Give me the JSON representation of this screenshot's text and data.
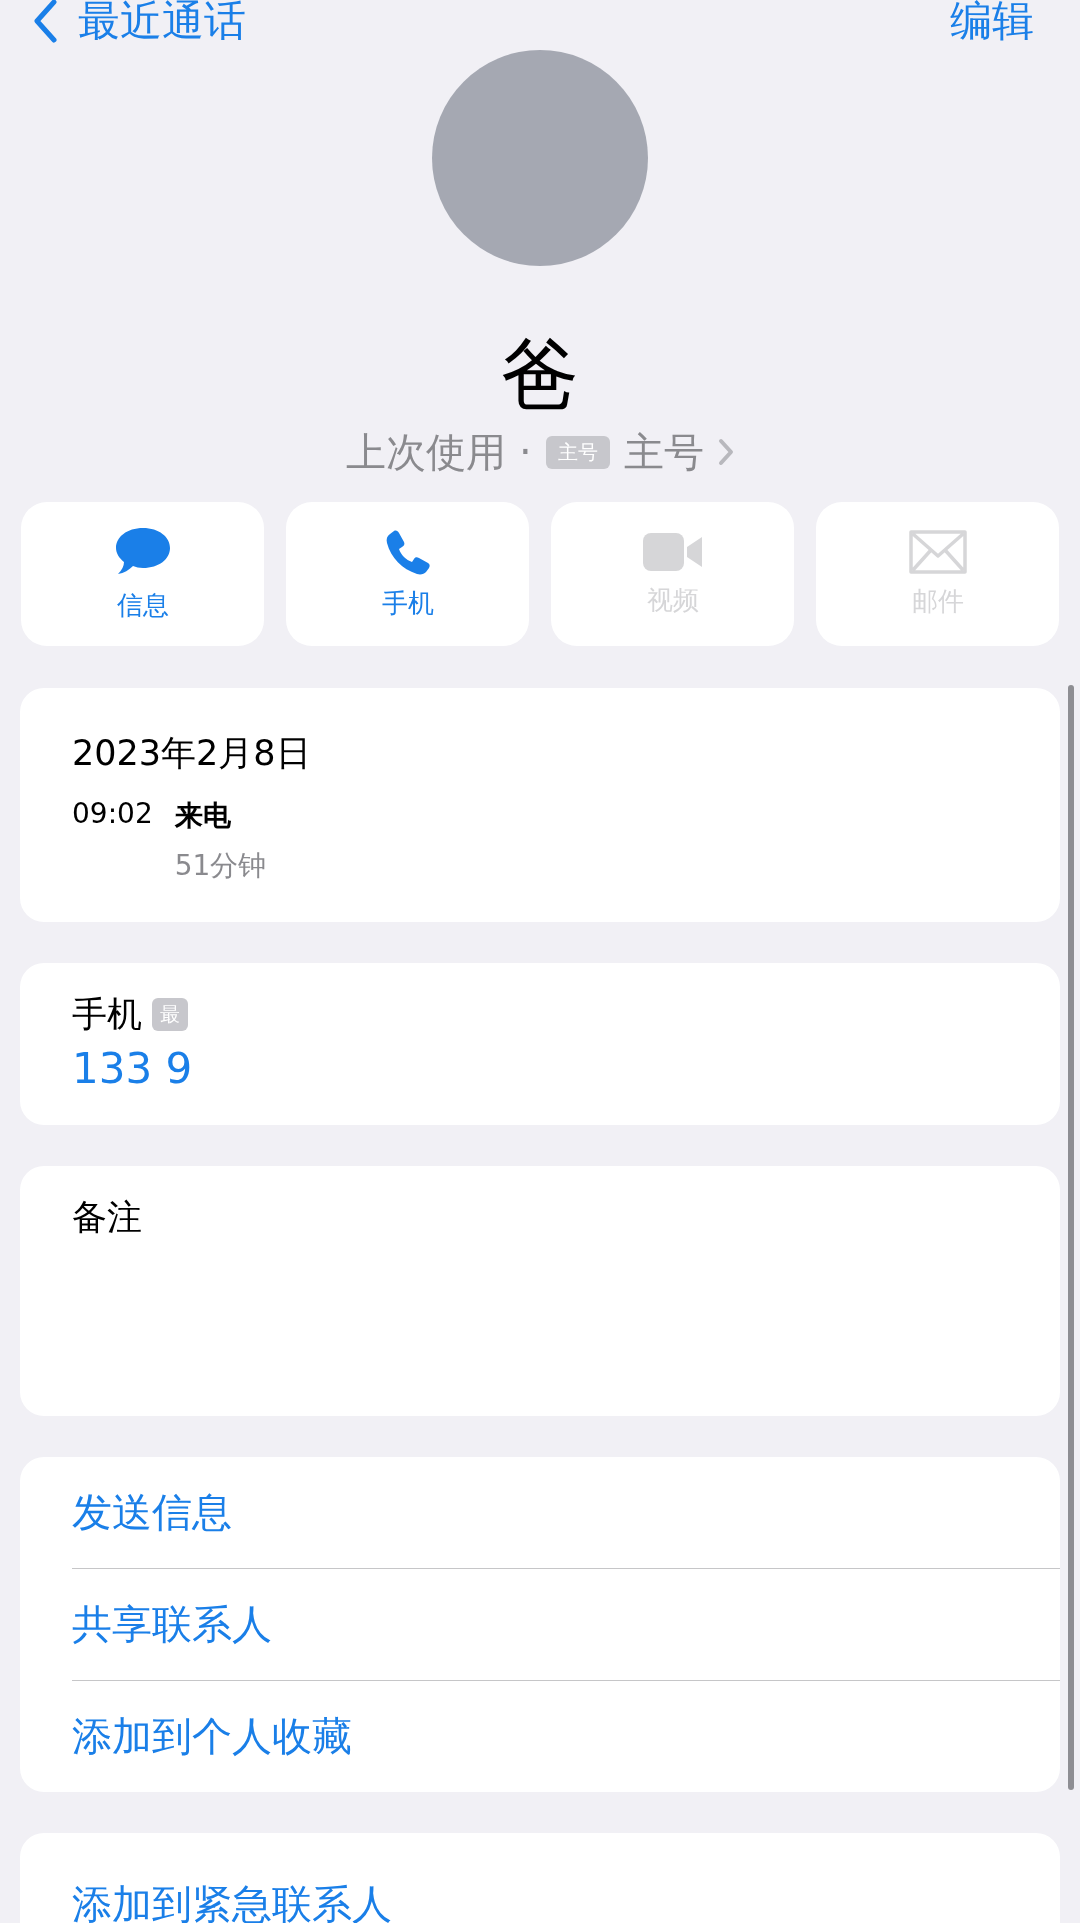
{
  "nav": {
    "back_label": "最近通话",
    "edit_label": "编辑"
  },
  "contact": {
    "name": "爸",
    "last_used_label": "上次使用 ·",
    "last_used_badge": "主号",
    "last_used_value": "主号"
  },
  "actions": [
    {
      "kind": "message",
      "label": "信息",
      "disabled": false
    },
    {
      "kind": "phone",
      "label": "手机",
      "disabled": false
    },
    {
      "kind": "video",
      "label": "视频",
      "disabled": true
    },
    {
      "kind": "mail",
      "label": "邮件",
      "disabled": true
    }
  ],
  "call_log": {
    "date": "2023年2月8日",
    "time": "09:02",
    "type": "来电",
    "duration": "51分钟"
  },
  "phone": {
    "label": "手机",
    "badge": "最",
    "number": "133 9"
  },
  "notes": {
    "label": "备注"
  },
  "menu": [
    "发送信息",
    "共享联系人",
    "添加到个人收藏"
  ],
  "emergency": "添加到紧急联系人"
}
